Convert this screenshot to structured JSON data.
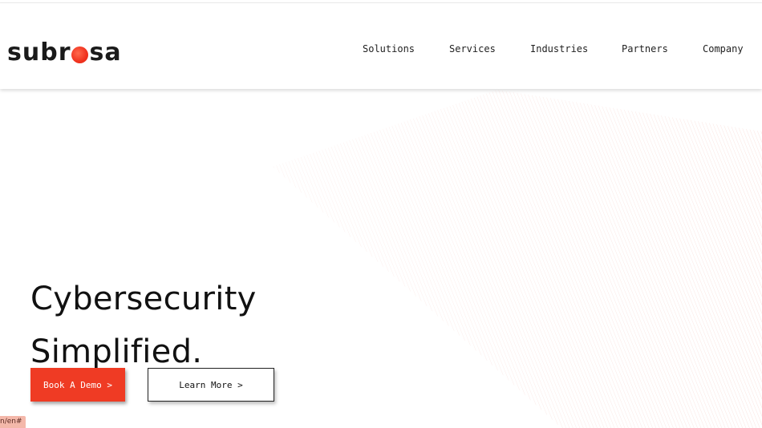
{
  "header": {
    "logo": {
      "text_before": "subr",
      "text_after": "sa",
      "accent_color": "#f0321e"
    },
    "nav": [
      {
        "label": "Solutions"
      },
      {
        "label": "Services"
      },
      {
        "label": "Industries"
      },
      {
        "label": "Partners"
      },
      {
        "label": "Company"
      }
    ]
  },
  "hero": {
    "title_line1": "Cybersecurity",
    "title_line2": "Simplified.",
    "buttons": {
      "demo": "Book A Demo >",
      "learn": "Learn More >"
    },
    "accent_color": "#ef3b24"
  },
  "status_bar": {
    "url": "n/en#"
  }
}
